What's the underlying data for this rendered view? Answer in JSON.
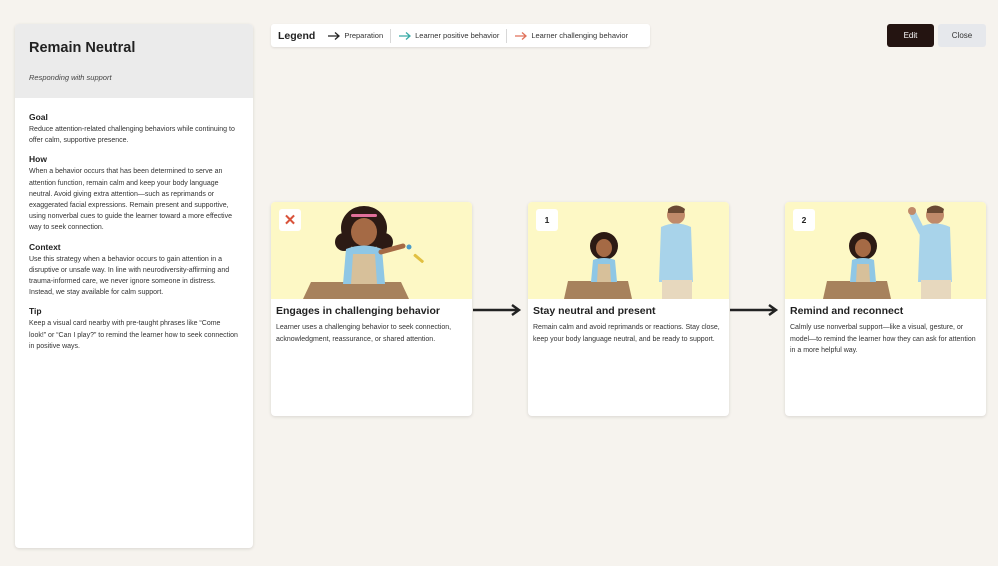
{
  "panel": {
    "title": "Remain Neutral",
    "subtitle": "Responding with support",
    "sections": [
      {
        "heading": "Goal",
        "text": "Reduce attention-related challenging behaviors while continuing to offer calm, supportive presence."
      },
      {
        "heading": "How",
        "text": "When a behavior occurs that has been determined to serve an attention function, remain calm and keep your body language neutral. Avoid giving extra attention—such as reprimands or exaggerated facial expressions. Remain present and supportive, using nonverbal cues to guide the learner toward a more effective way to seek connection."
      },
      {
        "heading": "Context",
        "text": "Use this strategy when a behavior occurs to gain attention in a disruptive or unsafe way. In line with neurodiversity-affirming and trauma-informed care, we never ignore someone in distress. Instead, we stay available for calm support."
      },
      {
        "heading": "Tip",
        "text": "Keep a visual card nearby with pre-taught phrases like “Come look!” or “Can I play?” to remind the learner how to seek connection in positive ways."
      }
    ]
  },
  "legend": {
    "title": "Legend",
    "items": [
      {
        "label": "Preparation",
        "color": "#222222"
      },
      {
        "label": "Learner positive behavior",
        "color": "#3aaba6"
      },
      {
        "label": "Learner challenging behavior",
        "color": "#e0715a"
      }
    ]
  },
  "buttons": {
    "edit": "Edit",
    "close": "Close"
  },
  "cards": [
    {
      "badge": "✕",
      "badge_icon": "x-mark-icon",
      "title": "Engages in challenging behavior",
      "desc": "Learner uses a challenging behavior to seek connection, acknowledgment, reassurance, or shared attention."
    },
    {
      "badge": "1",
      "title": "Stay neutral and present",
      "desc": "Remain calm and avoid reprimands or reactions. Stay close, keep your body language neutral, and be ready to support."
    },
    {
      "badge": "2",
      "title": "Remind and reconnect",
      "desc": "Calmly use nonverbal support—like a visual, gesture, or model—to remind the learner how they can ask for attention in a more helpful way."
    }
  ],
  "colors": {
    "accent_dark": "#241411",
    "card_image_bg": "#fdf8c5",
    "challenging": "#e0715a",
    "positive": "#3aaba6"
  }
}
